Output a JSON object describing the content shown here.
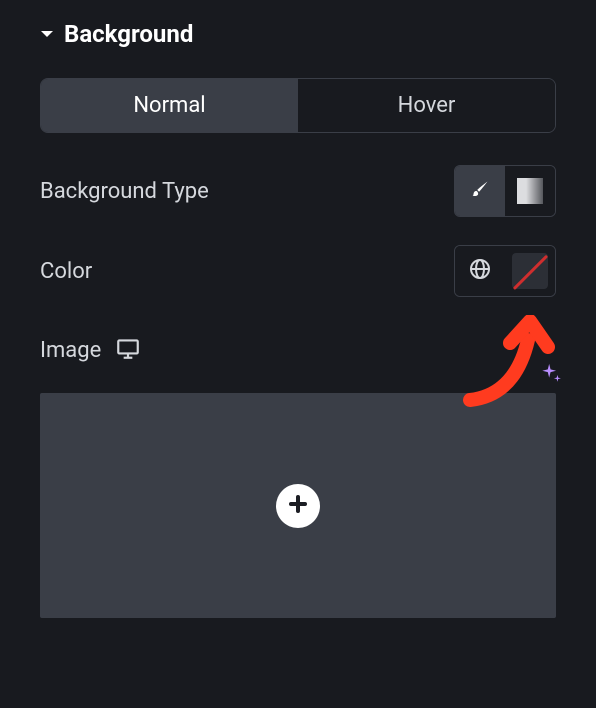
{
  "section": {
    "title": "Background"
  },
  "tabs": {
    "normal": "Normal",
    "hover": "Hover"
  },
  "background_type": {
    "label": "Background Type"
  },
  "color_row": {
    "label": "Color"
  },
  "image_row": {
    "label": "Image"
  }
}
